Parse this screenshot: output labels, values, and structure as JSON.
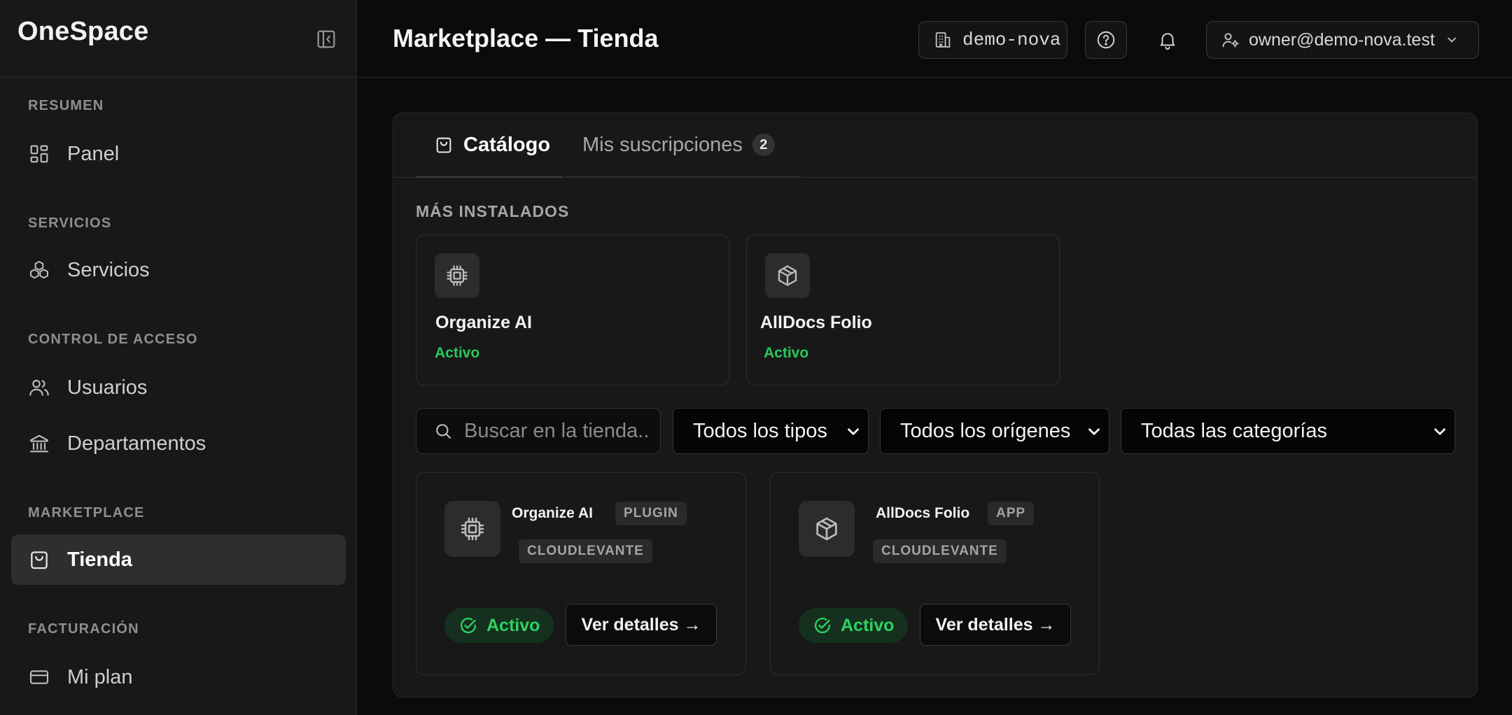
{
  "sidebar": {
    "brand": "OneSpace",
    "sections": [
      {
        "title": "RESUMEN",
        "items": [
          {
            "label": "Panel",
            "icon": "dashboard-icon"
          }
        ]
      },
      {
        "title": "SERVICIOS",
        "items": [
          {
            "label": "Servicios",
            "icon": "boxes-icon"
          }
        ]
      },
      {
        "title": "CONTROL DE ACCESO",
        "items": [
          {
            "label": "Usuarios",
            "icon": "users-icon"
          },
          {
            "label": "Departamentos",
            "icon": "building-columns-icon"
          }
        ]
      },
      {
        "title": "MARKETPLACE",
        "items": [
          {
            "label": "Tienda",
            "icon": "shopping-bag-icon",
            "active": true
          }
        ]
      },
      {
        "title": "FACTURACIÓN",
        "items": [
          {
            "label": "Mi plan",
            "icon": "credit-card-icon"
          }
        ]
      }
    ]
  },
  "header": {
    "title": "Marketplace — Tienda",
    "tenant": "demo-nova",
    "user_email": "owner@demo-nova.test"
  },
  "tabs": {
    "catalog": "Catálogo",
    "subscriptions": "Mis suscripciones",
    "subscriptions_count": "2"
  },
  "most_installed": {
    "title": "MÁS INSTALADOS",
    "items": [
      {
        "name": "Organize AI",
        "status": "Activo",
        "icon": "cpu-chip-icon"
      },
      {
        "name": "AllDocs Folio",
        "status": "Activo",
        "icon": "package-box-icon"
      }
    ]
  },
  "filters": {
    "search_placeholder": "Buscar en la tienda...",
    "type": "Todos los tipos",
    "origin": "Todos los orígenes",
    "category": "Todas las categorías"
  },
  "products": [
    {
      "name": "Organize AI",
      "type": "PLUGIN",
      "origin": "CLOUDLEVANTE",
      "status": "Activo",
      "action": "Ver detalles →",
      "icon": "cpu-chip-icon"
    },
    {
      "name": "AllDocs Folio",
      "type": "APP",
      "origin": "CLOUDLEVANTE",
      "status": "Activo",
      "action": "Ver detalles →",
      "icon": "package-box-icon"
    }
  ],
  "colors": {
    "accent_green": "#2fd063",
    "background": "#0b0b0c",
    "panel": "#181818"
  }
}
